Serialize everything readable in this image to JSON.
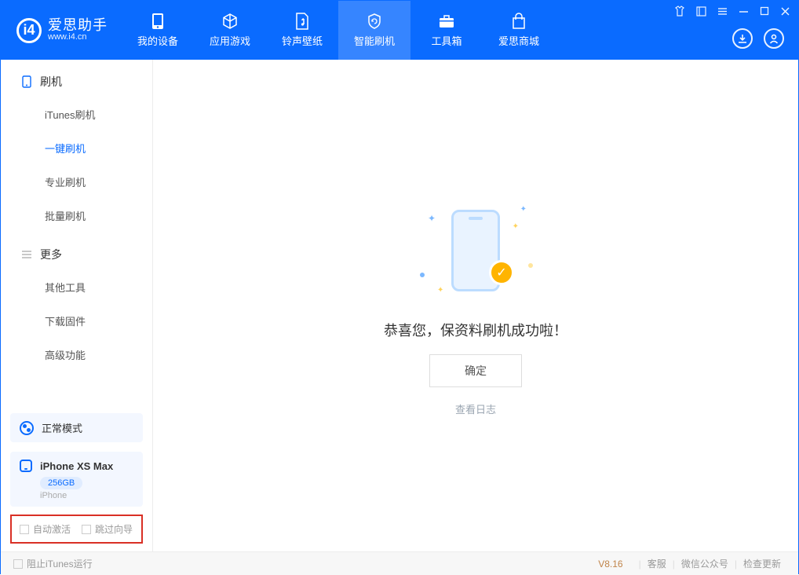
{
  "app": {
    "title": "爱思助手",
    "subtitle": "www.i4.cn"
  },
  "nav": {
    "tabs": [
      {
        "label": "我的设备"
      },
      {
        "label": "应用游戏"
      },
      {
        "label": "铃声壁纸"
      },
      {
        "label": "智能刷机"
      },
      {
        "label": "工具箱"
      },
      {
        "label": "爱思商城"
      }
    ]
  },
  "sidebar": {
    "sections": [
      {
        "title": "刷机",
        "items": [
          {
            "label": "iTunes刷机"
          },
          {
            "label": "一键刷机"
          },
          {
            "label": "专业刷机"
          },
          {
            "label": "批量刷机"
          }
        ]
      },
      {
        "title": "更多",
        "items": [
          {
            "label": "其他工具"
          },
          {
            "label": "下载固件"
          },
          {
            "label": "高级功能"
          }
        ]
      }
    ],
    "mode": "正常模式",
    "device": {
      "name": "iPhone XS Max",
      "storage": "256GB",
      "type": "iPhone"
    },
    "checkboxes": [
      {
        "label": "自动激活"
      },
      {
        "label": "跳过向导"
      }
    ]
  },
  "main": {
    "successText": "恭喜您，保资料刷机成功啦！",
    "confirmLabel": "确定",
    "logLink": "查看日志"
  },
  "footer": {
    "blockItunes": "阻止iTunes运行",
    "version": "V8.16",
    "links": [
      "客服",
      "微信公众号",
      "检查更新"
    ]
  }
}
